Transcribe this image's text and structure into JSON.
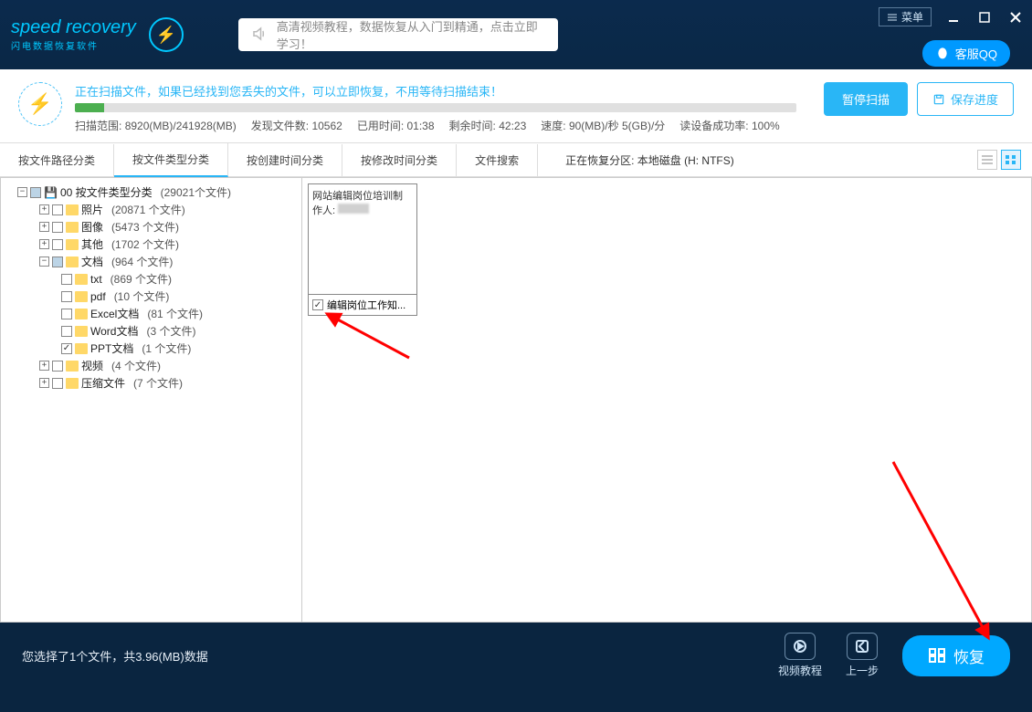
{
  "app": {
    "name": "speed recovery",
    "tagline": "闪电数据恢复软件",
    "menu_label": "菜单",
    "qq_label": "客服QQ"
  },
  "tutorial": {
    "text": "高清视频教程，数据恢复从入门到精通，点击立即学习！"
  },
  "scan": {
    "message": "正在扫描文件，如果已经找到您丢失的文件，可以立即恢复，不用等待扫描结束！",
    "range_label": "扫描范围:",
    "range_val": "8920(MB)/241928(MB)",
    "found_label": "发现文件数:",
    "found_val": "10562",
    "elapsed_label": "已用时间:",
    "elapsed_val": "01:38",
    "remain_label": "剩余时间:",
    "remain_val": "42:23",
    "speed_label": "速度:",
    "speed_val": "90(MB)/秒  5(GB)/分",
    "success_label": "读设备成功率:",
    "success_val": "100%",
    "pause_btn": "暂停扫描",
    "save_btn": "保存进度"
  },
  "tabs": {
    "t1": "按文件路径分类",
    "t2": "按文件类型分类",
    "t3": "按创建时间分类",
    "t4": "按修改时间分类",
    "t5": "文件搜索"
  },
  "partition": {
    "label": "正在恢复分区:",
    "val": "本地磁盘 (H: NTFS)"
  },
  "tree": {
    "root": {
      "label": "00 按文件类型分类",
      "count": "(29021个文件)"
    },
    "photo": {
      "label": "照片",
      "count": "(20871 个文件)"
    },
    "image": {
      "label": "图像",
      "count": "(5473 个文件)"
    },
    "other": {
      "label": "其他",
      "count": "(1702 个文件)"
    },
    "doc": {
      "label": "文档",
      "count": "(964 个文件)"
    },
    "txt": {
      "label": "txt",
      "count": "(869 个文件)"
    },
    "pdf": {
      "label": "pdf",
      "count": "(10 个文件)"
    },
    "excel": {
      "label": "Excel文档",
      "count": "(81 个文件)"
    },
    "word": {
      "label": "Word文档",
      "count": "(3 个文件)"
    },
    "ppt": {
      "label": "PPT文档",
      "count": "(1 个文件)"
    },
    "video": {
      "label": "视频",
      "count": "(4 个文件)"
    },
    "zip": {
      "label": "压缩文件",
      "count": "(7 个文件)"
    }
  },
  "file": {
    "preview_line1": "网站编辑岗位培训制",
    "preview_line2": "作人:",
    "name": "编辑岗位工作知..."
  },
  "footer": {
    "selection": "您选择了1个文件，共3.96(MB)数据",
    "video_btn": "视频教程",
    "prev_btn": "上一步",
    "recover_btn": "恢复"
  }
}
